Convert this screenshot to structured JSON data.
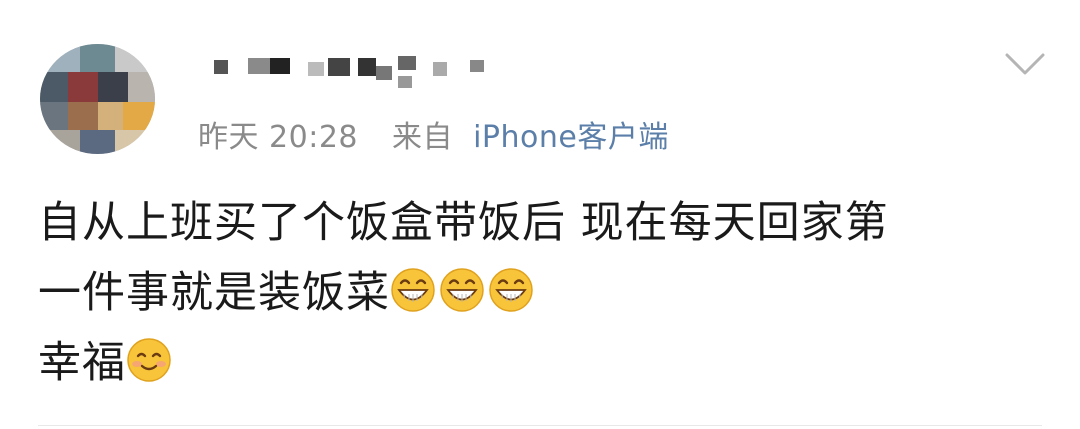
{
  "post": {
    "timestamp": "昨天 20:28",
    "source_label": "来自",
    "source_client": "iPhone客户端",
    "text_lines": [
      "自从上班买了个饭盒带饭后 现在每天回家第",
      "一件事就是装饭菜",
      "幸福"
    ]
  },
  "icons": {
    "more": "chevron-down-icon",
    "grin": "grin-emoji-icon",
    "smile": "smile-emoji-icon"
  },
  "colors": {
    "meta_text": "#8a8a8a",
    "client_link": "#5b7fa8",
    "body_text": "#1a1a1a"
  }
}
